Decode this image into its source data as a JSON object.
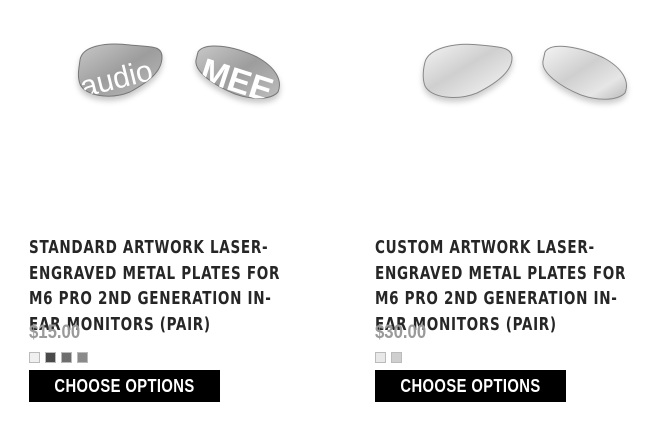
{
  "products": [
    {
      "title": "Standard Artwork Laser-Engraved Metal Plates for M6 Pro 2nd Generation In-Ear Monitors (Pair)",
      "price": "$15.00",
      "button_label": "Choose Options",
      "plate_logo_left": "audio",
      "plate_logo_right": "MEE",
      "swatch_colors": [
        "#f0f0f0",
        "#4a4a4a",
        "#6e6e6e",
        "#8a8a8a"
      ]
    },
    {
      "title": "Custom Artwork Laser-Engraved Metal Plates for M6 Pro 2nd Generation In-Ear Monitors (Pair)",
      "price": "$30.00",
      "button_label": "Choose Options",
      "swatch_colors": [
        "#e8e8e8",
        "#cfcfcf"
      ]
    }
  ]
}
